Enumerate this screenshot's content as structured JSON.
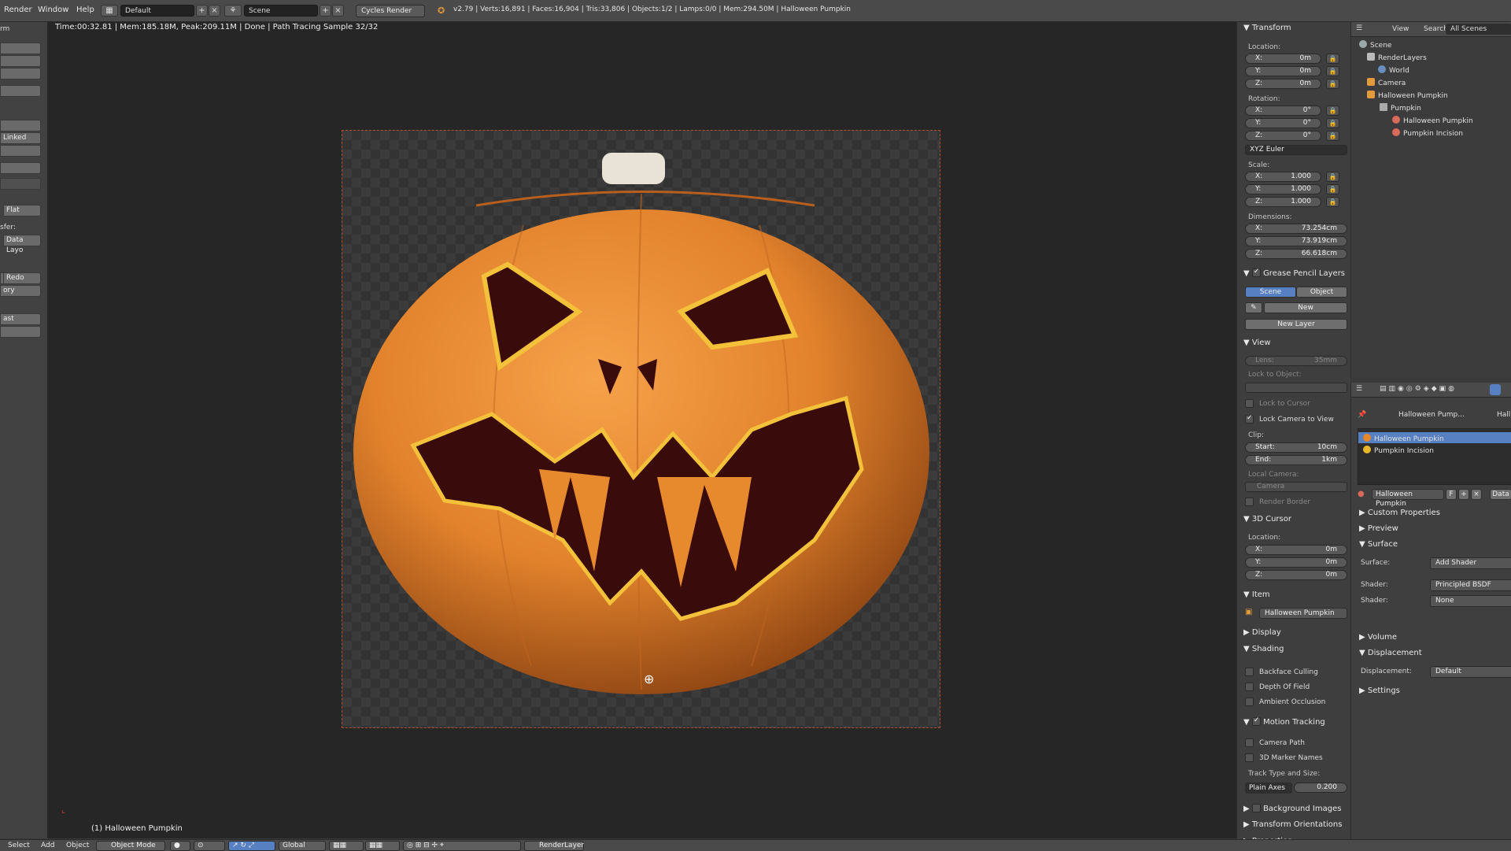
{
  "topbar": {
    "menus": [
      "Render",
      "Window",
      "Help"
    ],
    "layout": "Default",
    "scene": "Scene",
    "engine": "Cycles Render",
    "stats": "v2.79 | Verts:16,891 | Faces:16,904 | Tris:33,806 | Objects:1/2 | Lamps:0/0 | Mem:294.50M | Halloween Pumpkin"
  },
  "left_toolbar": {
    "tab": "rm",
    "linked": "Linked",
    "flat": "Flat",
    "sfer": "sfer:",
    "data_layo": "Data Layo",
    "redo": "Redo",
    "ory": "ory",
    "ast": "ast"
  },
  "viewport": {
    "status": "Time:00:32.81 | Mem:185.18M, Peak:209.11M | Done | Path Tracing Sample 32/32",
    "object_label": "(1) Halloween Pumpkin"
  },
  "npanel": {
    "transform": {
      "title": "Transform",
      "location_label": "Location:",
      "location": [
        {
          "k": "X:",
          "v": "0m"
        },
        {
          "k": "Y:",
          "v": "0m"
        },
        {
          "k": "Z:",
          "v": "0m"
        }
      ],
      "rotation_label": "Rotation:",
      "rotation": [
        {
          "k": "X:",
          "v": "0°"
        },
        {
          "k": "Y:",
          "v": "0°"
        },
        {
          "k": "Z:",
          "v": "0°"
        }
      ],
      "rotation_mode": "XYZ Euler",
      "scale_label": "Scale:",
      "scale": [
        {
          "k": "X:",
          "v": "1.000"
        },
        {
          "k": "Y:",
          "v": "1.000"
        },
        {
          "k": "Z:",
          "v": "1.000"
        }
      ],
      "dimensions_label": "Dimensions:",
      "dimensions": [
        {
          "k": "X:",
          "v": "73.254cm"
        },
        {
          "k": "Y:",
          "v": "73.919cm"
        },
        {
          "k": "Z:",
          "v": "66.618cm"
        }
      ]
    },
    "grease": {
      "title": "Grease Pencil Layers",
      "scene_tab": "Scene",
      "object_tab": "Object",
      "new": "New",
      "new_layer": "New Layer"
    },
    "view": {
      "title": "View",
      "lens_k": "Lens:",
      "lens_v": "35mm",
      "lock_to_object": "Lock to Object:",
      "lock_to_cursor": "Lock to Cursor",
      "lock_camera": "Lock Camera to View",
      "clip": "Clip:",
      "start_k": "Start:",
      "start_v": "10cm",
      "end_k": "End:",
      "end_v": "1km",
      "local_camera": "Local Camera:",
      "camera": "Camera",
      "render_border": "Render Border"
    },
    "cursor": {
      "title": "3D Cursor",
      "location_label": "Location:",
      "location": [
        {
          "k": "X:",
          "v": "0m"
        },
        {
          "k": "Y:",
          "v": "0m"
        },
        {
          "k": "Z:",
          "v": "0m"
        }
      ]
    },
    "item": {
      "title": "Item",
      "name": "Halloween Pumpkin"
    },
    "display": {
      "title": "Display"
    },
    "shading": {
      "title": "Shading",
      "backface": "Backface Culling",
      "dof": "Depth Of Field",
      "ao": "Ambient Occlusion"
    },
    "motion": {
      "title": "Motion Tracking",
      "camera_path": "Camera Path",
      "marker_names": "3D Marker Names",
      "track_label": "Track Type and Size:",
      "track_type": "Plain Axes",
      "track_size": "0.200"
    },
    "background_images": "Background Images",
    "transform_orientations": "Transform Orientations",
    "properties": "Properties"
  },
  "outliner": {
    "view": "View",
    "search": "Search",
    "scenes": "All Scenes",
    "tree": [
      "Scene",
      "RenderLayers",
      "World",
      "Camera",
      "Halloween Pumpkin",
      "Pumpkin",
      "Halloween Pumpkin",
      "Pumpkin Incision"
    ]
  },
  "properties": {
    "breadcrumb_obj": "Halloween Pump...",
    "breadcrumb_mat": "Hall",
    "materials": [
      "Halloween Pumpkin",
      "Pumpkin Incision"
    ],
    "material_name": "Halloween Pumpkin",
    "material_f": "F",
    "data": "Data",
    "custom_props": "Custom Properties",
    "preview": "Preview",
    "surface": "Surface",
    "surface_label": "Surface:",
    "surface_value": "Add Shader",
    "shader_label": "Shader:",
    "shader1": "Principled BSDF",
    "shader2": "None",
    "volume": "Volume",
    "displacement": "Displacement",
    "displacement_label": "Displacement:",
    "displacement_value": "Default",
    "settings": "Settings"
  },
  "bottombar": {
    "menus": [
      "Select",
      "Add",
      "Object"
    ],
    "mode": "Object Mode",
    "orientation": "Global",
    "renderlayer": "RenderLayer"
  },
  "colors": {
    "accent": "#5680c2",
    "pumpkin": "#e8862a",
    "frame": "#b0502a"
  }
}
